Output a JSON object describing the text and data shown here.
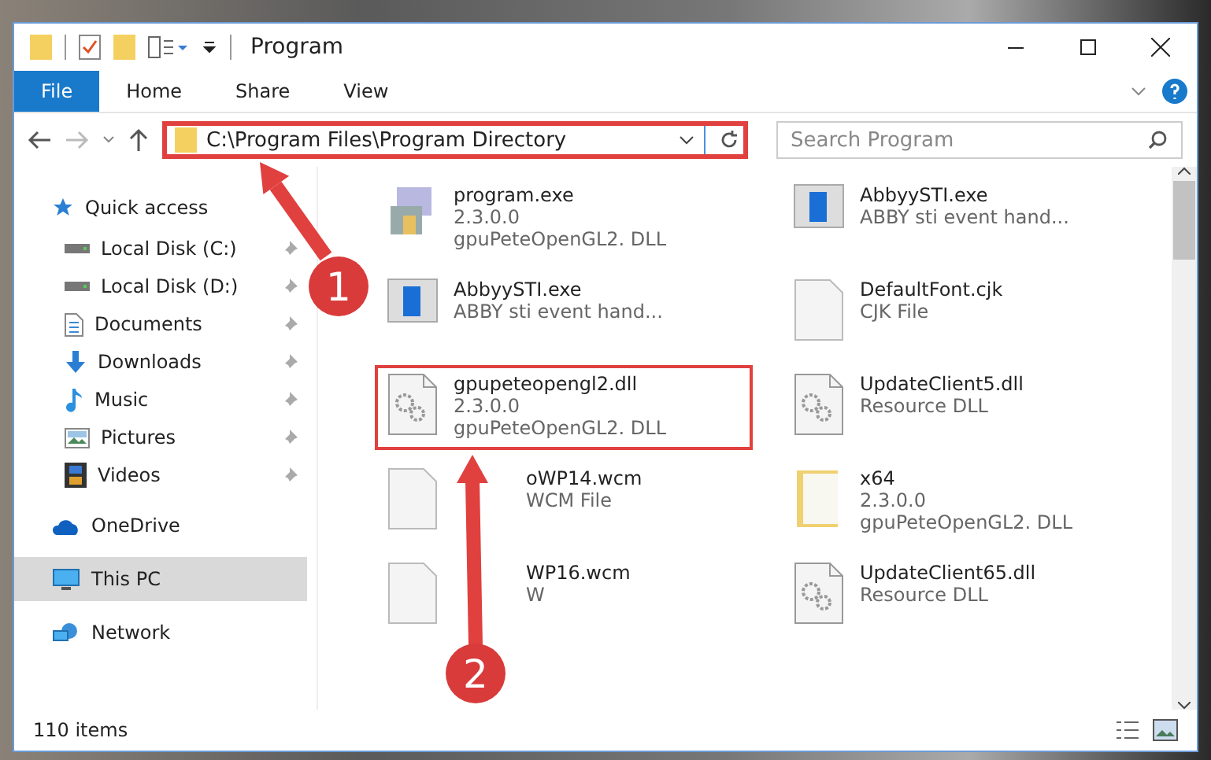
{
  "window": {
    "title": "Program"
  },
  "ribbon_tabs": [
    {
      "label": "File",
      "selected": true
    },
    {
      "label": "Home",
      "selected": false
    },
    {
      "label": "Share",
      "selected": false
    },
    {
      "label": "View",
      "selected": false
    }
  ],
  "address_bar": {
    "path": "C:\\Program Files\\Program Directory",
    "highlighted": true
  },
  "search": {
    "placeholder": "Search Program"
  },
  "sidebar": {
    "items": [
      {
        "label": "Quick access",
        "kind": "star",
        "pinned": false,
        "selected": false,
        "children": [
          {
            "label": "Local Disk (C:)",
            "kind": "drive",
            "pinned": true,
            "selected": false
          },
          {
            "label": "Local Disk (D:)",
            "kind": "drive",
            "pinned": true,
            "selected": false
          },
          {
            "label": "Documents",
            "kind": "document",
            "pinned": true,
            "selected": false
          },
          {
            "label": "Downloads",
            "kind": "download",
            "pinned": true,
            "selected": false
          },
          {
            "label": "Music",
            "kind": "music",
            "pinned": true,
            "selected": false
          },
          {
            "label": "Pictures",
            "kind": "pictures",
            "pinned": true,
            "selected": false
          },
          {
            "label": "Videos",
            "kind": "film",
            "pinned": true,
            "selected": false
          }
        ]
      },
      {
        "label": "OneDrive",
        "kind": "cloud",
        "pinned": false,
        "selected": false
      },
      {
        "label": "This PC",
        "kind": "monitor",
        "pinned": false,
        "selected": true
      },
      {
        "label": "Network",
        "kind": "network",
        "pinned": false,
        "selected": false
      }
    ]
  },
  "file_columns": [
    [
      {
        "name": "program.exe",
        "lines": [
          "2.3.0.0",
          "gpuPeteOpenGL2. DLL"
        ],
        "kind": "program",
        "highlighted": false,
        "covered": false
      },
      {
        "name": "AbbyySTI.exe",
        "lines": [
          "ABBY sti event hand..."
        ],
        "kind": "window",
        "highlighted": false,
        "covered": false
      },
      {
        "name": "gpupeteopengl2.dll",
        "lines": [
          "2.3.0.0",
          "gpuPeteOpenGL2. DLL"
        ],
        "kind": "gears",
        "highlighted": true,
        "covered": false
      },
      {
        "name": "oWP14.wcm",
        "lines": [
          "WCM File"
        ],
        "kind": "blank",
        "highlighted": false,
        "covered": true
      },
      {
        "name": "WP16.wcm",
        "lines": [
          "W"
        ],
        "kind": "blank",
        "highlighted": false,
        "covered": true
      }
    ],
    [
      {
        "name": "AbbyySTI.exe",
        "lines": [
          "ABBY sti event hand..."
        ],
        "kind": "window",
        "highlighted": false,
        "covered": false
      },
      {
        "name": "DefaultFont.cjk",
        "lines": [
          "CJK File"
        ],
        "kind": "blank",
        "highlighted": false,
        "covered": false
      },
      {
        "name": "UpdateClient5.dll",
        "lines": [
          "Resource DLL"
        ],
        "kind": "gears",
        "highlighted": false,
        "covered": false
      },
      {
        "name": "x64",
        "lines": [
          "2.3.0.0",
          "gpuPeteOpenGL2. DLL"
        ],
        "kind": "folder",
        "highlighted": false,
        "covered": false
      },
      {
        "name": "UpdateClient65.dll",
        "lines": [
          "Resource DLL"
        ],
        "kind": "gears",
        "highlighted": false,
        "covered": false
      }
    ]
  ],
  "status_bar": {
    "item_count": "110 items"
  },
  "annotations": [
    {
      "number": "1"
    },
    {
      "number": "2"
    }
  ]
}
